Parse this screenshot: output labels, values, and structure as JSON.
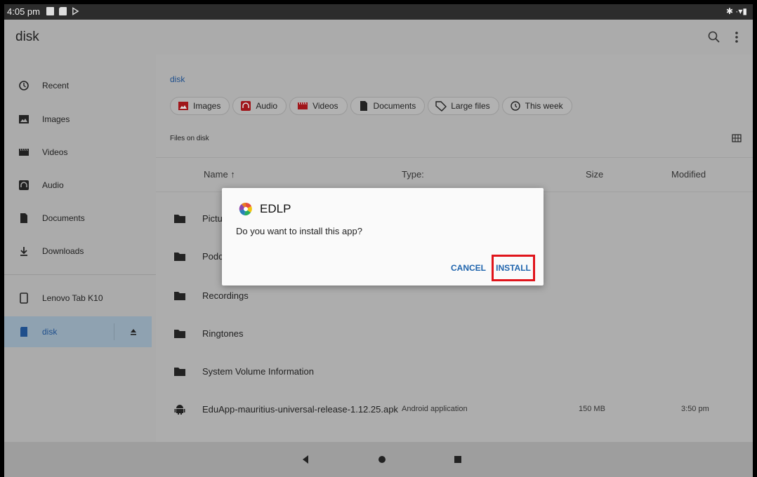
{
  "status_bar": {
    "time": "4:05 pm",
    "right_icons": "✱ ·▾▮"
  },
  "app_bar": {
    "title": "disk"
  },
  "sidebar": {
    "items": [
      {
        "label": "Recent",
        "icon": "clock-icon"
      },
      {
        "label": "Images",
        "icon": "image-icon"
      },
      {
        "label": "Videos",
        "icon": "video-icon"
      },
      {
        "label": "Audio",
        "icon": "audio-icon"
      },
      {
        "label": "Documents",
        "icon": "document-icon"
      },
      {
        "label": "Downloads",
        "icon": "download-icon"
      }
    ],
    "devices": [
      {
        "label": "Lenovo Tab K10",
        "icon": "tablet-icon"
      },
      {
        "label": "disk",
        "icon": "sdcard-icon"
      }
    ]
  },
  "main": {
    "breadcrumb": "disk",
    "chips": [
      "Images",
      "Audio",
      "Videos",
      "Documents",
      "Large files",
      "This week"
    ],
    "section_label": "Files on disk",
    "columns": {
      "name": "Name ↑",
      "type": "Type:",
      "size": "Size",
      "modified": "Modified"
    },
    "rows": [
      {
        "name": "Pictures",
        "type": "",
        "size": "",
        "modified": ""
      },
      {
        "name": "Podcasts",
        "type": "",
        "size": "",
        "modified": ""
      },
      {
        "name": "Recordings",
        "type": "",
        "size": "",
        "modified": ""
      },
      {
        "name": "Ringtones",
        "type": "",
        "size": "",
        "modified": ""
      },
      {
        "name": "System Volume Information",
        "type": "",
        "size": "",
        "modified": ""
      },
      {
        "name": "EduApp-mauritius-universal-release-1.12.25.apk",
        "type": "Android application",
        "size": "150 MB",
        "modified": "3:50 pm"
      }
    ]
  },
  "dialog": {
    "title": "EDLP",
    "message": "Do you want to install this app?",
    "cancel_label": "CANCEL",
    "install_label": "INSTALL"
  },
  "colors": {
    "accent": "#1f64ad",
    "highlight": "#e0141b"
  }
}
